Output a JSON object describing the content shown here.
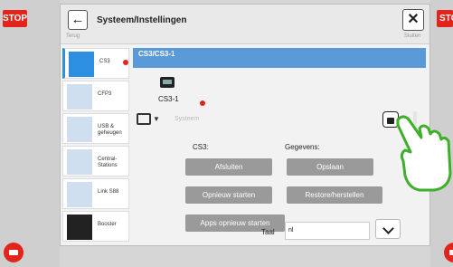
{
  "screen": {
    "stop_left": "STOP",
    "stop_right": "STOP"
  },
  "window": {
    "title": "Systeem/Instellingen",
    "back_label": "Terug",
    "close_label": "Sluiten"
  },
  "sidebar": {
    "items": [
      {
        "label": "CS3",
        "status_dot": true
      },
      {
        "label": "CFP3",
        "status_dot": false
      },
      {
        "label": "USB & geheugen",
        "status_dot": false
      },
      {
        "label": "Central-Stations",
        "status_dot": false
      },
      {
        "label": "Link S88",
        "status_dot": false
      },
      {
        "label": "Booster",
        "status_dot": false
      }
    ]
  },
  "main": {
    "header": "CS3/CS3-1",
    "device_name": "CS3-1",
    "system_label": "Systeem",
    "col_cs3": "CS3:",
    "col_gegevens": "Gegevens:",
    "buttons": {
      "afsluiten": "Afsluiten",
      "opslaan": "Opslaan",
      "opnieuw_starten": "Opnieuw starten",
      "restore": "Restore/herstellen",
      "apps_opnieuw": "Apps opnieuw starten"
    },
    "language_label": "Taal",
    "language_value": "nl"
  },
  "colors": {
    "accent": "#5b9ad8",
    "stop": "#e3241b",
    "button": "#9a9a9a"
  }
}
